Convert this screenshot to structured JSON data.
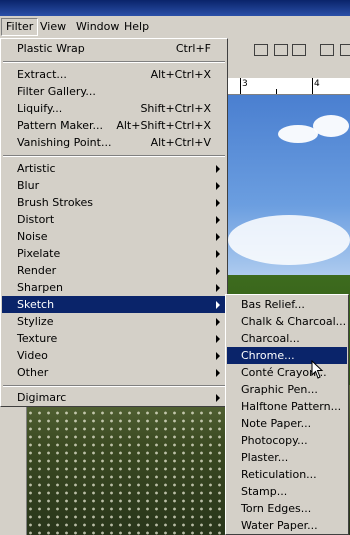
{
  "menubar": {
    "items": [
      {
        "label": "Filter"
      },
      {
        "label": "View"
      },
      {
        "label": "Window"
      },
      {
        "label": "Help"
      }
    ]
  },
  "ruler": {
    "marks": [
      "3",
      "4"
    ]
  },
  "filter_menu": {
    "top_items": [
      {
        "label": "Plastic Wrap",
        "shortcut": "Ctrl+F"
      }
    ],
    "tools": [
      {
        "label": "Extract...",
        "shortcut": "Alt+Ctrl+X"
      },
      {
        "label": "Filter Gallery...",
        "shortcut": ""
      },
      {
        "label": "Liquify...",
        "shortcut": "Shift+Ctrl+X"
      },
      {
        "label": "Pattern Maker...",
        "shortcut": "Alt+Shift+Ctrl+X"
      },
      {
        "label": "Vanishing Point...",
        "shortcut": "Alt+Ctrl+V"
      }
    ],
    "categories": [
      {
        "label": "Artistic"
      },
      {
        "label": "Blur"
      },
      {
        "label": "Brush Strokes"
      },
      {
        "label": "Distort"
      },
      {
        "label": "Noise"
      },
      {
        "label": "Pixelate"
      },
      {
        "label": "Render"
      },
      {
        "label": "Sharpen"
      },
      {
        "label": "Sketch"
      },
      {
        "label": "Stylize"
      },
      {
        "label": "Texture"
      },
      {
        "label": "Video"
      },
      {
        "label": "Other"
      }
    ],
    "plugins": [
      {
        "label": "Digimarc"
      }
    ],
    "selected_category": "Sketch"
  },
  "sketch_submenu": {
    "items": [
      "Bas Relief...",
      "Chalk & Charcoal...",
      "Charcoal...",
      "Chrome...",
      "Conté Crayon...",
      "Graphic Pen...",
      "Halftone Pattern...",
      "Note Paper...",
      "Photocopy...",
      "Plaster...",
      "Reticulation...",
      "Stamp...",
      "Torn Edges...",
      "Water Paper..."
    ],
    "selected": "Chrome..."
  },
  "colors": {
    "highlight": "#0a246a",
    "menu_bg": "#d4d0c8"
  }
}
